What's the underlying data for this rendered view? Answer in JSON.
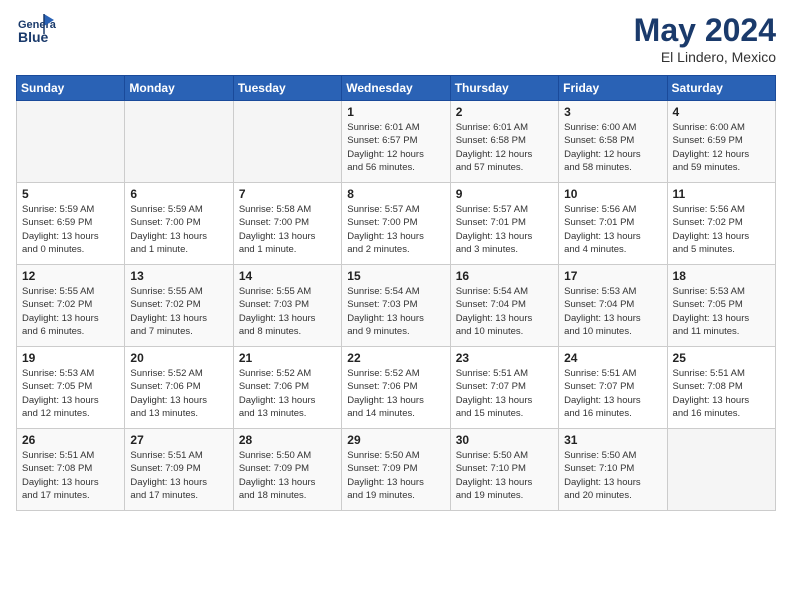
{
  "header": {
    "logo_line1": "General",
    "logo_line2": "Blue",
    "month": "May 2024",
    "location": "El Lindero, Mexico"
  },
  "weekdays": [
    "Sunday",
    "Monday",
    "Tuesday",
    "Wednesday",
    "Thursday",
    "Friday",
    "Saturday"
  ],
  "weeks": [
    [
      {
        "day": "",
        "info": ""
      },
      {
        "day": "",
        "info": ""
      },
      {
        "day": "",
        "info": ""
      },
      {
        "day": "1",
        "info": "Sunrise: 6:01 AM\nSunset: 6:57 PM\nDaylight: 12 hours\nand 56 minutes."
      },
      {
        "day": "2",
        "info": "Sunrise: 6:01 AM\nSunset: 6:58 PM\nDaylight: 12 hours\nand 57 minutes."
      },
      {
        "day": "3",
        "info": "Sunrise: 6:00 AM\nSunset: 6:58 PM\nDaylight: 12 hours\nand 58 minutes."
      },
      {
        "day": "4",
        "info": "Sunrise: 6:00 AM\nSunset: 6:59 PM\nDaylight: 12 hours\nand 59 minutes."
      }
    ],
    [
      {
        "day": "5",
        "info": "Sunrise: 5:59 AM\nSunset: 6:59 PM\nDaylight: 13 hours\nand 0 minutes."
      },
      {
        "day": "6",
        "info": "Sunrise: 5:59 AM\nSunset: 7:00 PM\nDaylight: 13 hours\nand 1 minute."
      },
      {
        "day": "7",
        "info": "Sunrise: 5:58 AM\nSunset: 7:00 PM\nDaylight: 13 hours\nand 1 minute."
      },
      {
        "day": "8",
        "info": "Sunrise: 5:57 AM\nSunset: 7:00 PM\nDaylight: 13 hours\nand 2 minutes."
      },
      {
        "day": "9",
        "info": "Sunrise: 5:57 AM\nSunset: 7:01 PM\nDaylight: 13 hours\nand 3 minutes."
      },
      {
        "day": "10",
        "info": "Sunrise: 5:56 AM\nSunset: 7:01 PM\nDaylight: 13 hours\nand 4 minutes."
      },
      {
        "day": "11",
        "info": "Sunrise: 5:56 AM\nSunset: 7:02 PM\nDaylight: 13 hours\nand 5 minutes."
      }
    ],
    [
      {
        "day": "12",
        "info": "Sunrise: 5:55 AM\nSunset: 7:02 PM\nDaylight: 13 hours\nand 6 minutes."
      },
      {
        "day": "13",
        "info": "Sunrise: 5:55 AM\nSunset: 7:02 PM\nDaylight: 13 hours\nand 7 minutes."
      },
      {
        "day": "14",
        "info": "Sunrise: 5:55 AM\nSunset: 7:03 PM\nDaylight: 13 hours\nand 8 minutes."
      },
      {
        "day": "15",
        "info": "Sunrise: 5:54 AM\nSunset: 7:03 PM\nDaylight: 13 hours\nand 9 minutes."
      },
      {
        "day": "16",
        "info": "Sunrise: 5:54 AM\nSunset: 7:04 PM\nDaylight: 13 hours\nand 10 minutes."
      },
      {
        "day": "17",
        "info": "Sunrise: 5:53 AM\nSunset: 7:04 PM\nDaylight: 13 hours\nand 10 minutes."
      },
      {
        "day": "18",
        "info": "Sunrise: 5:53 AM\nSunset: 7:05 PM\nDaylight: 13 hours\nand 11 minutes."
      }
    ],
    [
      {
        "day": "19",
        "info": "Sunrise: 5:53 AM\nSunset: 7:05 PM\nDaylight: 13 hours\nand 12 minutes."
      },
      {
        "day": "20",
        "info": "Sunrise: 5:52 AM\nSunset: 7:06 PM\nDaylight: 13 hours\nand 13 minutes."
      },
      {
        "day": "21",
        "info": "Sunrise: 5:52 AM\nSunset: 7:06 PM\nDaylight: 13 hours\nand 13 minutes."
      },
      {
        "day": "22",
        "info": "Sunrise: 5:52 AM\nSunset: 7:06 PM\nDaylight: 13 hours\nand 14 minutes."
      },
      {
        "day": "23",
        "info": "Sunrise: 5:51 AM\nSunset: 7:07 PM\nDaylight: 13 hours\nand 15 minutes."
      },
      {
        "day": "24",
        "info": "Sunrise: 5:51 AM\nSunset: 7:07 PM\nDaylight: 13 hours\nand 16 minutes."
      },
      {
        "day": "25",
        "info": "Sunrise: 5:51 AM\nSunset: 7:08 PM\nDaylight: 13 hours\nand 16 minutes."
      }
    ],
    [
      {
        "day": "26",
        "info": "Sunrise: 5:51 AM\nSunset: 7:08 PM\nDaylight: 13 hours\nand 17 minutes."
      },
      {
        "day": "27",
        "info": "Sunrise: 5:51 AM\nSunset: 7:09 PM\nDaylight: 13 hours\nand 17 minutes."
      },
      {
        "day": "28",
        "info": "Sunrise: 5:50 AM\nSunset: 7:09 PM\nDaylight: 13 hours\nand 18 minutes."
      },
      {
        "day": "29",
        "info": "Sunrise: 5:50 AM\nSunset: 7:09 PM\nDaylight: 13 hours\nand 19 minutes."
      },
      {
        "day": "30",
        "info": "Sunrise: 5:50 AM\nSunset: 7:10 PM\nDaylight: 13 hours\nand 19 minutes."
      },
      {
        "day": "31",
        "info": "Sunrise: 5:50 AM\nSunset: 7:10 PM\nDaylight: 13 hours\nand 20 minutes."
      },
      {
        "day": "",
        "info": ""
      }
    ]
  ]
}
